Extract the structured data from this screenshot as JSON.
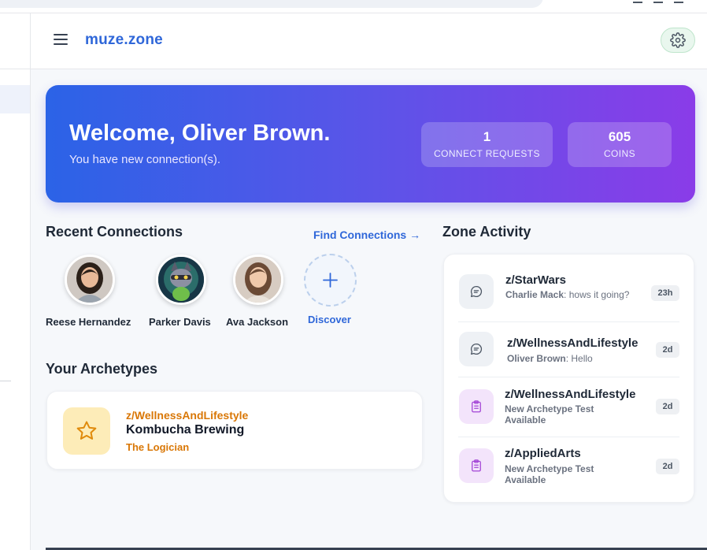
{
  "app": {
    "logo": "muze.zone",
    "menu_icon": "hamburger-menu-icon",
    "settings_icon": "gear-icon"
  },
  "colors": {
    "brand": "#2f67d9",
    "hero_start": "#2b63e7",
    "hero_end": "#8a3ce8",
    "archetype_accent": "#d97706",
    "settings_bg": "#e9f7ee"
  },
  "hero": {
    "title": "Welcome, Oliver Brown.",
    "subtitle": "You have new connection(s).",
    "stats": [
      {
        "value": "1",
        "label": "CONNECT REQUESTS"
      },
      {
        "value": "605",
        "label": "COINS"
      }
    ]
  },
  "recent_connections": {
    "title": "Recent Connections",
    "find_link": "Find Connections →",
    "people": [
      {
        "name": "Reese Hernandez",
        "avatar": "woman-portrait"
      },
      {
        "name": "Parker Davis",
        "avatar": "raccoon-illustration"
      },
      {
        "name": "Ava Jackson",
        "avatar": "woman-portrait"
      }
    ],
    "discover": {
      "label": "Discover",
      "icon": "plus-icon"
    }
  },
  "archetypes": {
    "title": "Your Archetypes",
    "items": [
      {
        "zone": "z/WellnessAndLifestyle",
        "name": "Kombucha Brewing",
        "type": "The Logician",
        "icon": "star-icon"
      }
    ]
  },
  "zone_activity": {
    "title": "Zone Activity",
    "items": [
      {
        "zone": "z/StarWars",
        "author": "Charlie Mack",
        "message": ": hows it going?",
        "time": "23h",
        "icon": "chat-bubble-icon"
      },
      {
        "zone": "z/WellnessAndLifestyle",
        "author": "Oliver Brown",
        "message": ": Hello",
        "time": "2d",
        "icon": "chat-bubble-icon"
      },
      {
        "zone": "z/WellnessAndLifestyle",
        "author": "",
        "message": "New Archetype Test Available",
        "time": "2d",
        "icon": "clipboard-icon"
      },
      {
        "zone": "z/AppliedArts",
        "author": "",
        "message": "New Archetype Test Available",
        "time": "2d",
        "icon": "clipboard-icon"
      }
    ]
  }
}
